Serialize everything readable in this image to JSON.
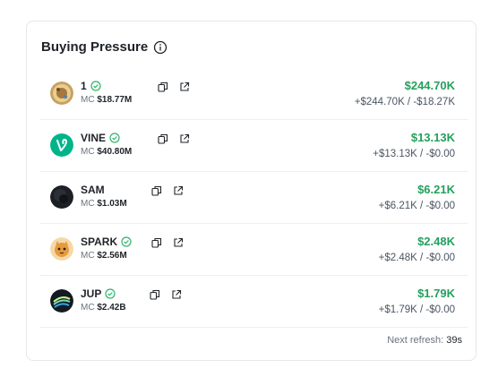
{
  "panel": {
    "title": "Buying Pressure",
    "info_icon": "info-icon"
  },
  "tokens": [
    {
      "name": "1",
      "mc_label": "MC",
      "mc_value": "$18.77M",
      "verified": true,
      "main_value": "$244.70K",
      "sub_value": "+$244.70K / -$18.27K",
      "avatar": "coin-gold-avatar"
    },
    {
      "name": "VINE",
      "mc_label": "MC",
      "mc_value": "$40.80M",
      "verified": true,
      "main_value": "$13.13K",
      "sub_value": "+$13.13K / -$0.00",
      "avatar": "vine-logo-avatar"
    },
    {
      "name": "SAM",
      "mc_label": "MC",
      "mc_value": "$1.03M",
      "verified": false,
      "main_value": "$6.21K",
      "sub_value": "+$6.21K / -$0.00",
      "avatar": "dark-circle-avatar"
    },
    {
      "name": "SPARK",
      "mc_label": "MC",
      "mc_value": "$2.56M",
      "verified": true,
      "main_value": "$2.48K",
      "sub_value": "+$2.48K / -$0.00",
      "avatar": "spark-cat-avatar"
    },
    {
      "name": "JUP",
      "mc_label": "MC",
      "mc_value": "$2.42B",
      "verified": true,
      "main_value": "$1.79K",
      "sub_value": "+$1.79K / -$0.00",
      "avatar": "jupiter-logo-avatar"
    }
  ],
  "footer": {
    "refresh_label": "Next refresh:",
    "refresh_count": "39s"
  },
  "colors": {
    "positive": "#22a05c",
    "verified": "#2fb36b"
  }
}
